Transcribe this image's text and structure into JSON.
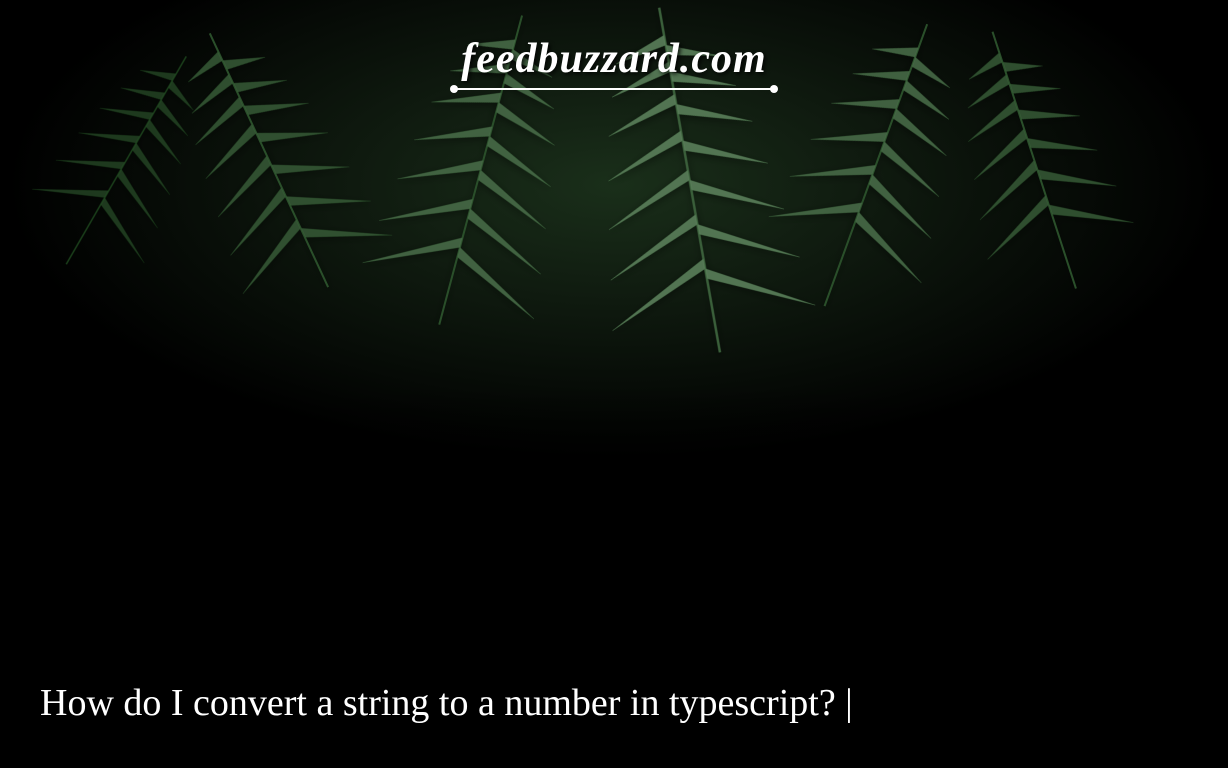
{
  "logo": {
    "text": "feedbuzzard.com"
  },
  "article": {
    "title": "How do I convert a string to a number in typescript? |"
  }
}
